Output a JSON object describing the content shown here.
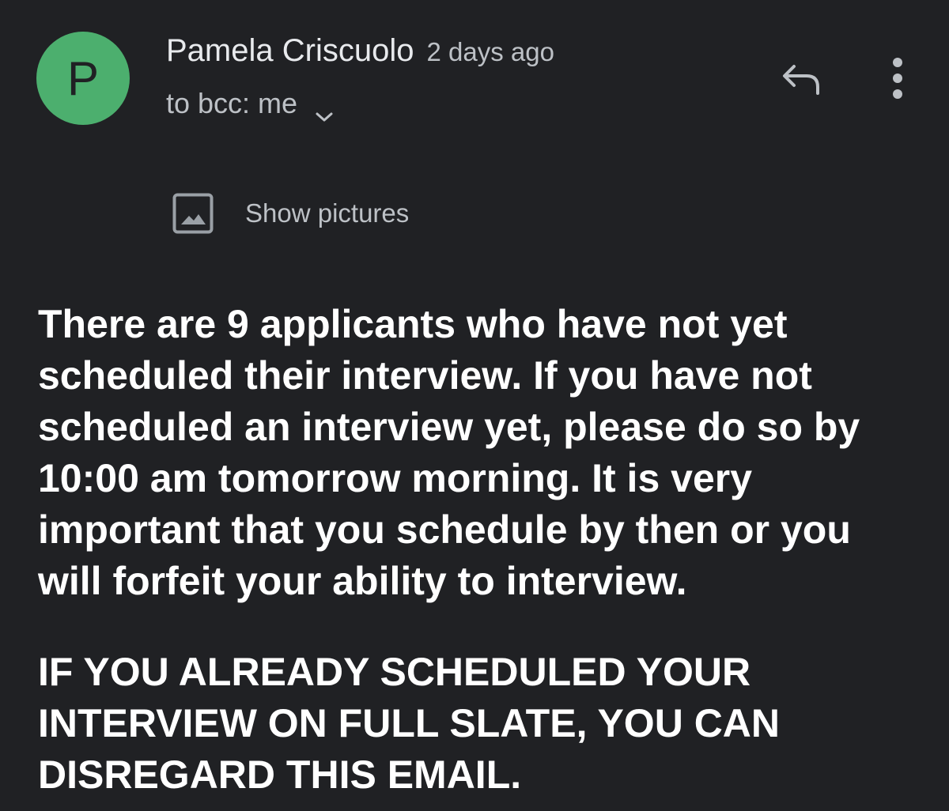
{
  "header": {
    "avatar_letter": "P",
    "avatar_color": "#4caf6e",
    "sender_name": "Pamela Criscuolo",
    "time": "2 days ago",
    "recipients": "to bcc: me",
    "recipients_toggle_icon": "chevron-down-icon",
    "reply_icon": "reply-icon",
    "more_icon": "more-vertical-icon"
  },
  "images_notice": {
    "icon": "image-icon",
    "label": "Show pictures"
  },
  "message": {
    "paragraph_1": "There are 9 applicants who have not yet\nscheduled their interview.  If you have not\nscheduled an interview yet, please do so by\n10:00 am tomorrow morning.  It is very\nimportant that you schedule by then or you\nwill forfeit your ability to interview.",
    "paragraph_2": "IF YOU ALREADY SCHEDULED YOUR\nINTERVIEW ON FULL SLATE, YOU CAN\nDISREGARD THIS EMAIL."
  },
  "colors": {
    "background": "#202124",
    "primary_text": "#e8eaed",
    "secondary_text": "#bdc1c6",
    "body_text": "#ffffff"
  }
}
